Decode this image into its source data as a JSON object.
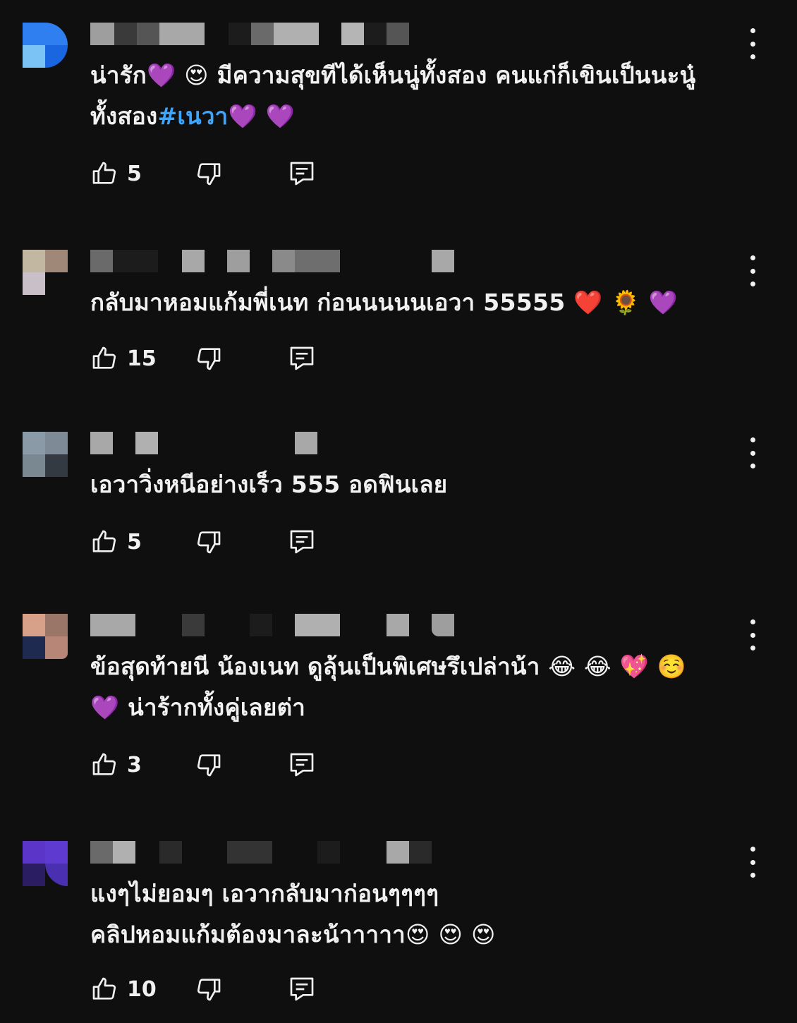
{
  "comments": [
    {
      "avatar_colors": [
        "#2f7ff0",
        "#2f7ff0",
        "#7cc3f5",
        "#1a66e0"
      ],
      "text": "น่ารัก💜 😍 มีความสุขทีได้เห็นนู่ทั้งสอง คนแก่ก็เขินเป็นนะนู๋",
      "text_line2_prefix": "ทั้งสอง",
      "hashtag": "#เนวา",
      "text_line2_suffix": "💜 💜",
      "likes": "5"
    },
    {
      "avatar_colors": [
        "#c2b7a0",
        "#a08878",
        "#c8bfc8",
        "#0f0f0f"
      ],
      "text": "กลับมาหอมแก้มพี่เนท ก่อนนนนนเอวา 55555 ❤️ 🌻 💜",
      "likes": "15"
    },
    {
      "avatar_colors": [
        "#8a9aa6",
        "#7e8b96",
        "#7a8892",
        "#333a42"
      ],
      "text": "เอวาวิ่งหนีอย่างเร็ว 555 อดฟินเลย",
      "likes": "5"
    },
    {
      "avatar_colors": [
        "#d6a089",
        "#9a7668",
        "#1f2a50",
        "#b78676"
      ],
      "text": "ข้อสุดท้ายนี น้องเนท ดูลุ้นเป็นพิเศษรึเปล่าน้า 😂 😂 💖 ☺️\n💜 น่าร้ากทั้งคู่เลยต่า",
      "likes": "3"
    },
    {
      "avatar_colors": [
        "#5a35c8",
        "#5e3ad0",
        "#2a1d62",
        "#4a2fb0"
      ],
      "text": "แงๆไม่ยอมๆ เอวากลับมาก่อนๆๆๆๆ\nคลิปหอมแก้มต้องมาละน้าาาาา😍 😍 😍",
      "likes": "10"
    }
  ],
  "icons": {
    "like": "thumbs-up-icon",
    "dislike": "thumbs-down-icon",
    "reply": "reply-icon",
    "menu": "more-vert-icon"
  }
}
